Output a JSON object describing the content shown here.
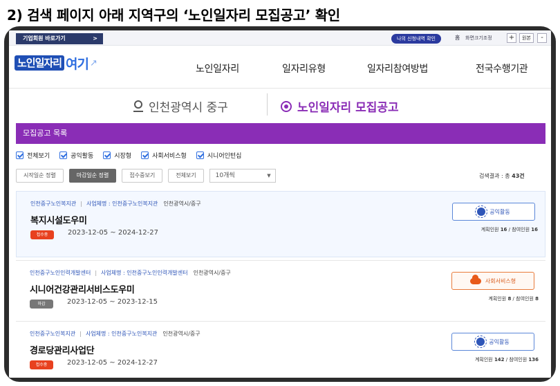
{
  "heading": "2) 검색 페이지 아래 지역구의 ‘노인일자리 모집공고’ 확인",
  "utilbar": {
    "corp_button": "기업회원 바로가기",
    "corp_arrow": ">",
    "my_button": "나의 신청내역 확인",
    "home": "홈",
    "font_size_label": "화면크기조정",
    "plus": "+",
    "reset": "원본",
    "minus": "-"
  },
  "header": {
    "logo_main": "노인일자리",
    "logo_sub": "여기",
    "logo_mark": "↗",
    "nav": [
      "노인일자리",
      "일자리유형",
      "일자리참여방법",
      "전국수행기관"
    ]
  },
  "region": {
    "location": "인천광역시 중구",
    "section": "노인일자리 모집공고"
  },
  "list": {
    "title": "모집공고 목록",
    "filters": [
      "전체보기",
      "공익활동",
      "시장형",
      "사회서비스형",
      "시니어인턴십"
    ],
    "tools": [
      "시작일순 정렬",
      "마감일순 정렬",
      "접수중보기",
      "전체보기"
    ],
    "per_page": "10개씩",
    "result_label": "검색결과 : 총",
    "result_count": "43건"
  },
  "jobs": [
    {
      "org": "인천중구노인복지관",
      "project": "사업체명 : 인천중구노인복지관",
      "addr": "인천광역시/중구",
      "title": "복지시설도우미",
      "status": "접수중",
      "dates": "2023-12-05 ~ 2024-12-27",
      "type": "공익활동",
      "plan_label": "계획인원",
      "plan": "16",
      "join_label": "참여인원",
      "join": "16"
    },
    {
      "org": "인천중구노인인력개발센터",
      "project": "사업체명 : 인천중구노인인력개발센터",
      "addr": "인천광역시/중구",
      "title": "시니어건강관리서비스도우미",
      "status": "마감",
      "dates": "2023-12-05 ~ 2023-12-15",
      "type": "사회서비스형",
      "plan_label": "계획인원",
      "plan": "8",
      "join_label": "참여인원",
      "join": "8"
    },
    {
      "org": "인천중구노인복지관",
      "project": "사업체명 : 인천중구노인복지관",
      "addr": "인천광역시/중구",
      "title": "경로당관리사업단",
      "status": "접수중",
      "dates": "2023-12-05 ~ 2024-12-27",
      "type": "공익활동",
      "plan_label": "계획인원",
      "plan": "142",
      "join_label": "참여인원",
      "join": "136"
    }
  ],
  "colors": {
    "accent_purple": "#8a2db6",
    "brand_blue": "#1f4fb5",
    "status_open": "#e8411f",
    "status_closed": "#777777"
  },
  "icons": {
    "location": "location-pin-icon",
    "section": "record-icon",
    "public": "sun-icon",
    "social": "cloud-icon"
  }
}
